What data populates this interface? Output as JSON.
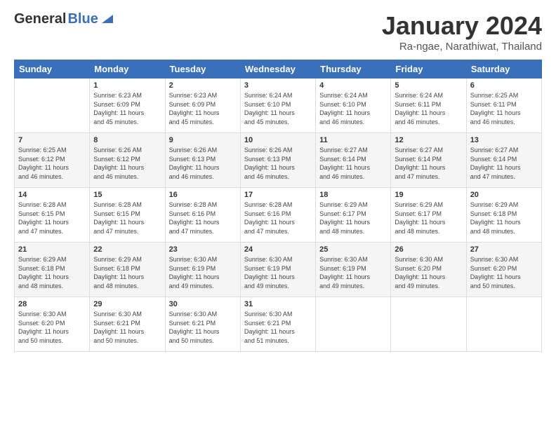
{
  "header": {
    "logo_general": "General",
    "logo_blue": "Blue",
    "month_title": "January 2024",
    "location": "Ra-ngae, Narathiwat, Thailand"
  },
  "columns": [
    "Sunday",
    "Monday",
    "Tuesday",
    "Wednesday",
    "Thursday",
    "Friday",
    "Saturday"
  ],
  "weeks": [
    [
      {
        "day": "",
        "info": ""
      },
      {
        "day": "1",
        "info": "Sunrise: 6:23 AM\nSunset: 6:09 PM\nDaylight: 11 hours\nand 45 minutes."
      },
      {
        "day": "2",
        "info": "Sunrise: 6:23 AM\nSunset: 6:09 PM\nDaylight: 11 hours\nand 45 minutes."
      },
      {
        "day": "3",
        "info": "Sunrise: 6:24 AM\nSunset: 6:10 PM\nDaylight: 11 hours\nand 45 minutes."
      },
      {
        "day": "4",
        "info": "Sunrise: 6:24 AM\nSunset: 6:10 PM\nDaylight: 11 hours\nand 46 minutes."
      },
      {
        "day": "5",
        "info": "Sunrise: 6:24 AM\nSunset: 6:11 PM\nDaylight: 11 hours\nand 46 minutes."
      },
      {
        "day": "6",
        "info": "Sunrise: 6:25 AM\nSunset: 6:11 PM\nDaylight: 11 hours\nand 46 minutes."
      }
    ],
    [
      {
        "day": "7",
        "info": "Sunrise: 6:25 AM\nSunset: 6:12 PM\nDaylight: 11 hours\nand 46 minutes."
      },
      {
        "day": "8",
        "info": "Sunrise: 6:26 AM\nSunset: 6:12 PM\nDaylight: 11 hours\nand 46 minutes."
      },
      {
        "day": "9",
        "info": "Sunrise: 6:26 AM\nSunset: 6:13 PM\nDaylight: 11 hours\nand 46 minutes."
      },
      {
        "day": "10",
        "info": "Sunrise: 6:26 AM\nSunset: 6:13 PM\nDaylight: 11 hours\nand 46 minutes."
      },
      {
        "day": "11",
        "info": "Sunrise: 6:27 AM\nSunset: 6:14 PM\nDaylight: 11 hours\nand 46 minutes."
      },
      {
        "day": "12",
        "info": "Sunrise: 6:27 AM\nSunset: 6:14 PM\nDaylight: 11 hours\nand 47 minutes."
      },
      {
        "day": "13",
        "info": "Sunrise: 6:27 AM\nSunset: 6:14 PM\nDaylight: 11 hours\nand 47 minutes."
      }
    ],
    [
      {
        "day": "14",
        "info": "Sunrise: 6:28 AM\nSunset: 6:15 PM\nDaylight: 11 hours\nand 47 minutes."
      },
      {
        "day": "15",
        "info": "Sunrise: 6:28 AM\nSunset: 6:15 PM\nDaylight: 11 hours\nand 47 minutes."
      },
      {
        "day": "16",
        "info": "Sunrise: 6:28 AM\nSunset: 6:16 PM\nDaylight: 11 hours\nand 47 minutes."
      },
      {
        "day": "17",
        "info": "Sunrise: 6:28 AM\nSunset: 6:16 PM\nDaylight: 11 hours\nand 47 minutes."
      },
      {
        "day": "18",
        "info": "Sunrise: 6:29 AM\nSunset: 6:17 PM\nDaylight: 11 hours\nand 48 minutes."
      },
      {
        "day": "19",
        "info": "Sunrise: 6:29 AM\nSunset: 6:17 PM\nDaylight: 11 hours\nand 48 minutes."
      },
      {
        "day": "20",
        "info": "Sunrise: 6:29 AM\nSunset: 6:18 PM\nDaylight: 11 hours\nand 48 minutes."
      }
    ],
    [
      {
        "day": "21",
        "info": "Sunrise: 6:29 AM\nSunset: 6:18 PM\nDaylight: 11 hours\nand 48 minutes."
      },
      {
        "day": "22",
        "info": "Sunrise: 6:29 AM\nSunset: 6:18 PM\nDaylight: 11 hours\nand 48 minutes."
      },
      {
        "day": "23",
        "info": "Sunrise: 6:30 AM\nSunset: 6:19 PM\nDaylight: 11 hours\nand 49 minutes."
      },
      {
        "day": "24",
        "info": "Sunrise: 6:30 AM\nSunset: 6:19 PM\nDaylight: 11 hours\nand 49 minutes."
      },
      {
        "day": "25",
        "info": "Sunrise: 6:30 AM\nSunset: 6:19 PM\nDaylight: 11 hours\nand 49 minutes."
      },
      {
        "day": "26",
        "info": "Sunrise: 6:30 AM\nSunset: 6:20 PM\nDaylight: 11 hours\nand 49 minutes."
      },
      {
        "day": "27",
        "info": "Sunrise: 6:30 AM\nSunset: 6:20 PM\nDaylight: 11 hours\nand 50 minutes."
      }
    ],
    [
      {
        "day": "28",
        "info": "Sunrise: 6:30 AM\nSunset: 6:20 PM\nDaylight: 11 hours\nand 50 minutes."
      },
      {
        "day": "29",
        "info": "Sunrise: 6:30 AM\nSunset: 6:21 PM\nDaylight: 11 hours\nand 50 minutes."
      },
      {
        "day": "30",
        "info": "Sunrise: 6:30 AM\nSunset: 6:21 PM\nDaylight: 11 hours\nand 50 minutes."
      },
      {
        "day": "31",
        "info": "Sunrise: 6:30 AM\nSunset: 6:21 PM\nDaylight: 11 hours\nand 51 minutes."
      },
      {
        "day": "",
        "info": ""
      },
      {
        "day": "",
        "info": ""
      },
      {
        "day": "",
        "info": ""
      }
    ]
  ]
}
